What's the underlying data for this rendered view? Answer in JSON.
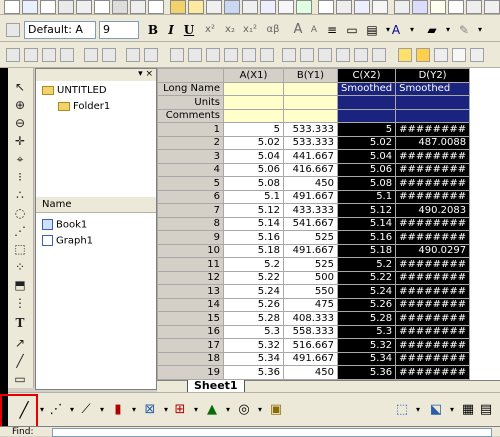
{
  "format_toolbar": {
    "font_name": "Default: A",
    "font_size": "9",
    "bold": "B",
    "italic": "I",
    "underline": "U",
    "superscript": "x²",
    "subscript": "x₂",
    "supsub": "x₁²",
    "greek": "αβ",
    "grow_font": "A",
    "shrink_font": "A"
  },
  "explorer": {
    "root": "UNTITLED",
    "folder": "Folder1",
    "name_header": "Name",
    "items": [
      "Book1",
      "Graph1"
    ],
    "header_pin": "▾ ×"
  },
  "worksheet": {
    "columns": [
      "A(X1)",
      "B(Y1)",
      "C(X2)",
      "D(Y2)"
    ],
    "meta_rows": [
      {
        "label": "Long Name",
        "values": [
          "",
          "",
          "Smoothed",
          "Smoothed"
        ]
      },
      {
        "label": "Units",
        "values": [
          "",
          "",
          "",
          ""
        ]
      },
      {
        "label": "Comments",
        "values": [
          "",
          "",
          "",
          ""
        ]
      }
    ],
    "rows": [
      {
        "n": "1",
        "a": "5",
        "b": "533.333",
        "c": "5",
        "d": "########"
      },
      {
        "n": "2",
        "a": "5.02",
        "b": "533.333",
        "c": "5.02",
        "d": "487.0088"
      },
      {
        "n": "3",
        "a": "5.04",
        "b": "441.667",
        "c": "5.04",
        "d": "########"
      },
      {
        "n": "4",
        "a": "5.06",
        "b": "416.667",
        "c": "5.06",
        "d": "########"
      },
      {
        "n": "5",
        "a": "5.08",
        "b": "450",
        "c": "5.08",
        "d": "########"
      },
      {
        "n": "6",
        "a": "5.1",
        "b": "491.667",
        "c": "5.1",
        "d": "########"
      },
      {
        "n": "7",
        "a": "5.12",
        "b": "433.333",
        "c": "5.12",
        "d": "490.2083"
      },
      {
        "n": "8",
        "a": "5.14",
        "b": "541.667",
        "c": "5.14",
        "d": "########"
      },
      {
        "n": "9",
        "a": "5.16",
        "b": "525",
        "c": "5.16",
        "d": "########"
      },
      {
        "n": "10",
        "a": "5.18",
        "b": "491.667",
        "c": "5.18",
        "d": "490.0297"
      },
      {
        "n": "11",
        "a": "5.2",
        "b": "525",
        "c": "5.2",
        "d": "########"
      },
      {
        "n": "12",
        "a": "5.22",
        "b": "500",
        "c": "5.22",
        "d": "########"
      },
      {
        "n": "13",
        "a": "5.24",
        "b": "550",
        "c": "5.24",
        "d": "########"
      },
      {
        "n": "14",
        "a": "5.26",
        "b": "475",
        "c": "5.26",
        "d": "########"
      },
      {
        "n": "15",
        "a": "5.28",
        "b": "408.333",
        "c": "5.28",
        "d": "########"
      },
      {
        "n": "16",
        "a": "5.3",
        "b": "558.333",
        "c": "5.3",
        "d": "########"
      },
      {
        "n": "17",
        "a": "5.32",
        "b": "516.667",
        "c": "5.32",
        "d": "########"
      },
      {
        "n": "18",
        "a": "5.34",
        "b": "491.667",
        "c": "5.34",
        "d": "########"
      },
      {
        "n": "19",
        "a": "5.36",
        "b": "450",
        "c": "5.36",
        "d": "########"
      }
    ],
    "sheet_tab": "Sheet1"
  },
  "find_label": "Find:"
}
